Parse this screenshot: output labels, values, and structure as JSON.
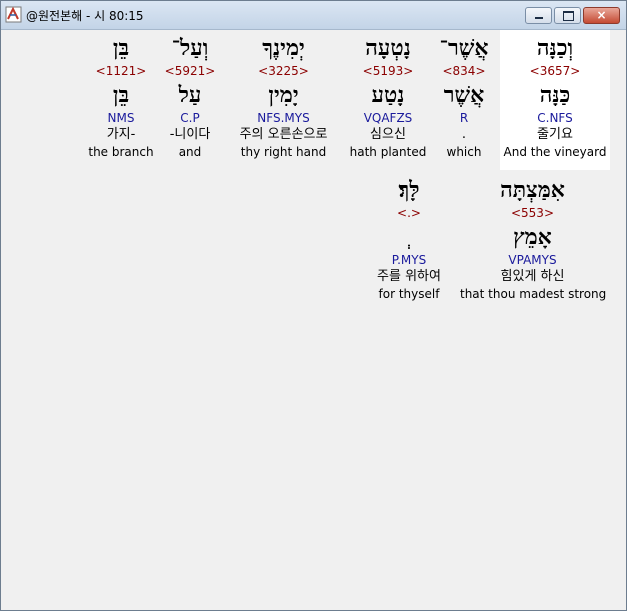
{
  "window": {
    "title": "@원전본해 - 시 80:15",
    "icon": "app-icon",
    "controls": {
      "minimize": "minimize-icon",
      "maximize": "maximize-icon",
      "close": "×"
    }
  },
  "words": [
    {
      "hebrew": "וְכַנָּה",
      "strong": "<3657>",
      "root": "כַּנָּה",
      "morph": "C.NFS",
      "korean": "줄기요",
      "english": "And the vineyard"
    },
    {
      "hebrew": "אֲשֶׁר־",
      "strong": "<834>",
      "root": "אֲשֶׁר",
      "morph": "R",
      "korean": ".",
      "english": "which"
    },
    {
      "hebrew": "נָטְעָה",
      "strong": "<5193>",
      "root": "נָטַע",
      "morph": "VQAFZS",
      "korean": "심으신",
      "english": "hath planted"
    },
    {
      "hebrew": "יְמִינֶךָ",
      "strong": "<3225>",
      "root": "יָמִין",
      "morph": "NFS.MYS",
      "korean": "주의 오른손으로",
      "english": "thy right hand"
    },
    {
      "hebrew": "וְעַל־",
      "strong": "<5921>",
      "root": "עַל",
      "morph": "C.P",
      "korean": "-니이다",
      "english": "and"
    },
    {
      "hebrew": "בֵּן",
      "strong": "<1121>",
      "root": "בֵּן",
      "morph": "NMS",
      "korean": "가지-",
      "english": "the branch"
    },
    {
      "hebrew": "אִמַּצְתָּה",
      "strong": "<553>",
      "root": "אָמֵץ",
      "morph": "VPAMYS",
      "korean": "힘있게 하신",
      "english": "that thou madest strong"
    },
    {
      "hebrew": "לָּךְ׃",
      "strong": "<.>",
      "root": "ְ",
      "morph": "P.MYS",
      "korean": "주를 위하여",
      "english": "for thyself"
    }
  ]
}
